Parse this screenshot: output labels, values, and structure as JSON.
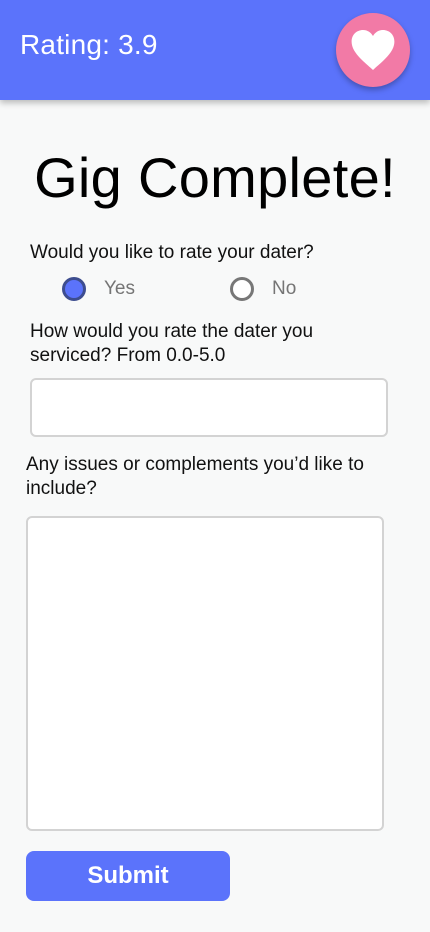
{
  "header": {
    "rating_text": "Rating: 3.9",
    "heart_icon": "heart-icon",
    "background_color": "#5b73fb",
    "heart_button_color": "#f27aa6"
  },
  "main": {
    "title": "Gig Complete!",
    "rate_question": "Would you like to rate your dater?",
    "rate_options": [
      {
        "label": "Yes",
        "selected": true
      },
      {
        "label": "No",
        "selected": false
      }
    ],
    "rating_question": "How would you rate the dater you serviced? From 0.0-5.0",
    "rating_input": {
      "value": "",
      "placeholder": ""
    },
    "comments_question": "Any issues or complements you’d like to include?",
    "comments_input": {
      "value": "",
      "placeholder": ""
    },
    "submit_label": "Submit"
  },
  "colors": {
    "accent": "#5b73fb",
    "heart": "#f27aa6",
    "background": "#f8f9f9"
  }
}
